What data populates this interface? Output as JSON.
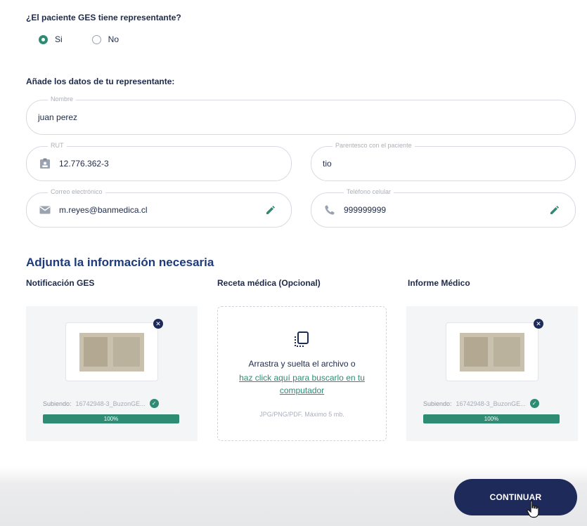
{
  "representative": {
    "question": "¿El paciente GES tiene representante?",
    "options": [
      {
        "label": "Si",
        "checked": true
      },
      {
        "label": "No",
        "checked": false
      }
    ]
  },
  "form": {
    "subtitle": "Añade los datos de tu representante:",
    "nombre": {
      "label": "Nombre",
      "value": "juan perez"
    },
    "rut": {
      "label": "RUT",
      "value": "12.776.362-3",
      "icon": "id-badge-icon"
    },
    "parentesco": {
      "label": "Parentesco con el paciente",
      "value": "tio"
    },
    "correo": {
      "label": "Correo electrónico",
      "value": "m.reyes@banmedica.cl",
      "icon": "mail-icon"
    },
    "telefono": {
      "label": "Teléfono celular",
      "value": "999999999",
      "icon": "phone-icon"
    }
  },
  "attachments": {
    "title": "Adjunta la información necesaria",
    "notificacion": {
      "title": "Notificación GES",
      "status_prefix": "Subiendo:",
      "file_name": "16742948-3_BuzonGE...",
      "progress_label": "100%",
      "progress": 1.0
    },
    "receta": {
      "title": "Receta médica (Opcional)",
      "drop_text": "Arrastra y suelta el archivo o",
      "link_text": "haz click aquí para buscarlo en tu computador",
      "hint": "JPG/PNG/PDF. Máximo 5 mb."
    },
    "informe": {
      "title": "Informe Médico",
      "status_prefix": "Subiendo:",
      "file_name": "16742948-3_BuzonGE...",
      "progress_label": "100%",
      "progress": 1.0
    }
  },
  "footer": {
    "continue_label": "CONTINUAR"
  },
  "colors": {
    "primary": "#1e2a5a",
    "accent": "#2e8b74",
    "heading": "#1e3a7a"
  }
}
